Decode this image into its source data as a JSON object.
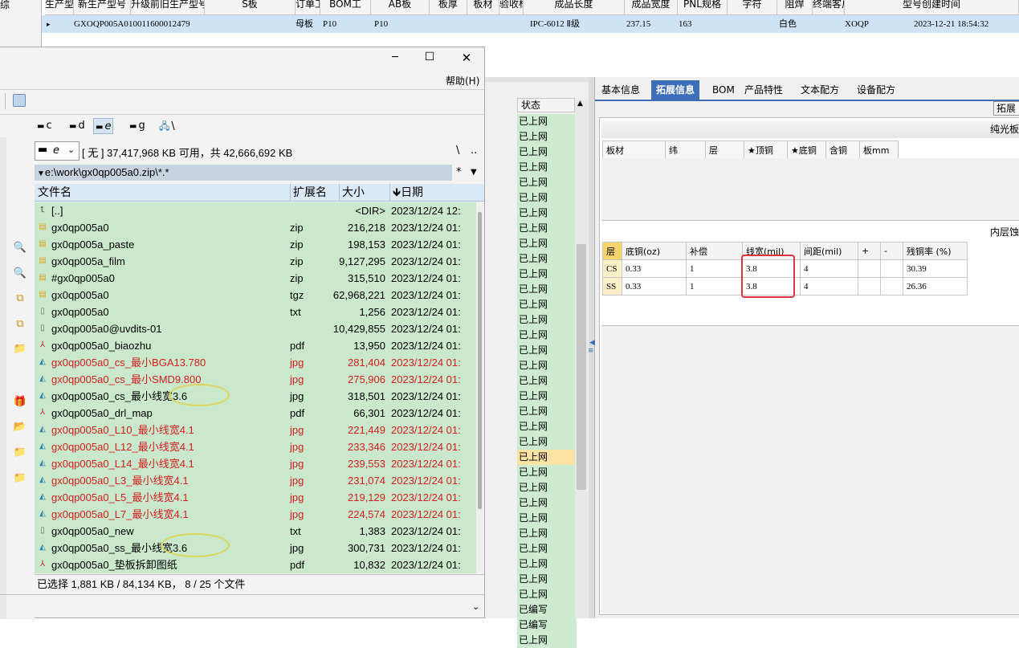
{
  "top_grid": {
    "left_stub": "综",
    "headers": [
      "生产型号",
      "新生产型号",
      "升级前旧生产型号",
      "S板",
      "订单工",
      "BOM工",
      "AB板",
      "板厚",
      "板材",
      "验收标准",
      "成品长度",
      "成品宽度",
      "PNL规格",
      "字符",
      "阻焊",
      "终端客户代码",
      "型号创建时间"
    ],
    "row": {
      "marker": "▸",
      "cells": [
        "GXOQP005A0",
        "10011600012479",
        "",
        "母板",
        "P10",
        "P10",
        "",
        "",
        "",
        "IPC-6012 Ⅱ级",
        "237.15",
        "163",
        "",
        "白色",
        "XOQP",
        "2023-12-21 18:54:32"
      ]
    }
  },
  "window": {
    "controls": {
      "minimize": "─",
      "maximize": "☐",
      "close": "✕"
    },
    "menu_help": "帮助(H)",
    "drives": [
      "c",
      "d",
      "e",
      "g",
      "\\"
    ],
    "drive_combo": "e",
    "free_space": "[ 无 ]  37,417,968 KB 可用，共 42,666,692 KB",
    "btn_root": "\\",
    "btn_up": "..",
    "path": "e:\\work\\gx0qp005a0.zip\\*.*",
    "path_star": "*",
    "columns": {
      "name": "文件名",
      "ext": "扩展名",
      "size": "大小",
      "date": "日期"
    },
    "files": [
      {
        "icon": "up",
        "name": "[..]",
        "ext": "",
        "size": "<DIR>",
        "date": "2023/12/24 12:",
        "red": false
      },
      {
        "icon": "zip",
        "name": "gx0qp005a0",
        "ext": "zip",
        "size": "216,218",
        "date": "2023/12/24 01:",
        "red": false
      },
      {
        "icon": "zip",
        "name": "gx0qp005a_paste",
        "ext": "zip",
        "size": "198,153",
        "date": "2023/12/24 01:",
        "red": false
      },
      {
        "icon": "zip",
        "name": "gx0qp005a_film",
        "ext": "zip",
        "size": "9,127,295",
        "date": "2023/12/24 01:",
        "red": false
      },
      {
        "icon": "zip",
        "name": "#gx0qp005a0",
        "ext": "zip",
        "size": "315,510",
        "date": "2023/12/24 01:",
        "red": false
      },
      {
        "icon": "zip",
        "name": "gx0qp005a0",
        "ext": "tgz",
        "size": "62,968,221",
        "date": "2023/12/24 01:",
        "red": false
      },
      {
        "icon": "txt",
        "name": "gx0qp005a0",
        "ext": "txt",
        "size": "1,256",
        "date": "2023/12/24 01:",
        "red": false
      },
      {
        "icon": "txt",
        "name": "gx0qp005a0@uvdits-01",
        "ext": "",
        "size": "10,429,855",
        "date": "2023/12/24 01:",
        "red": false
      },
      {
        "icon": "pdf",
        "name": "gx0qp005a0_biaozhu",
        "ext": "pdf",
        "size": "13,950",
        "date": "2023/12/24 01:",
        "red": false
      },
      {
        "icon": "img",
        "name": "gx0qp005a0_cs_最小BGA13.780",
        "ext": "jpg",
        "size": "281,404",
        "date": "2023/12/24 01:",
        "red": true
      },
      {
        "icon": "img",
        "name": "gx0qp005a0_cs_最小SMD9.800",
        "ext": "jpg",
        "size": "275,906",
        "date": "2023/12/24 01:",
        "red": true
      },
      {
        "icon": "img",
        "name": "gx0qp005a0_cs_最小线宽3.6",
        "ext": "jpg",
        "size": "318,501",
        "date": "2023/12/24 01:",
        "red": false
      },
      {
        "icon": "pdf",
        "name": "gx0qp005a0_drl_map",
        "ext": "pdf",
        "size": "66,301",
        "date": "2023/12/24 01:",
        "red": false
      },
      {
        "icon": "img",
        "name": "gx0qp005a0_L10_最小线宽4.1",
        "ext": "jpg",
        "size": "221,449",
        "date": "2023/12/24 01:",
        "red": true
      },
      {
        "icon": "img",
        "name": "gx0qp005a0_L12_最小线宽4.1",
        "ext": "jpg",
        "size": "233,346",
        "date": "2023/12/24 01:",
        "red": true
      },
      {
        "icon": "img",
        "name": "gx0qp005a0_L14_最小线宽4.1",
        "ext": "jpg",
        "size": "239,553",
        "date": "2023/12/24 01:",
        "red": true
      },
      {
        "icon": "img",
        "name": "gx0qp005a0_L3_最小线宽4.1",
        "ext": "jpg",
        "size": "231,074",
        "date": "2023/12/24 01:",
        "red": true
      },
      {
        "icon": "img",
        "name": "gx0qp005a0_L5_最小线宽4.1",
        "ext": "jpg",
        "size": "219,129",
        "date": "2023/12/24 01:",
        "red": true
      },
      {
        "icon": "img",
        "name": "gx0qp005a0_L7_最小线宽4.1",
        "ext": "jpg",
        "size": "224,574",
        "date": "2023/12/24 01:",
        "red": true
      },
      {
        "icon": "txt",
        "name": "gx0qp005a0_new",
        "ext": "txt",
        "size": "1,383",
        "date": "2023/12/24 01:",
        "red": false
      },
      {
        "icon": "img",
        "name": "gx0qp005a0_ss_最小线宽3.6",
        "ext": "jpg",
        "size": "300,731",
        "date": "2023/12/24 01:",
        "red": false
      },
      {
        "icon": "pdf",
        "name": "gx0qp005a0_垫板拆卸图纸",
        "ext": "pdf",
        "size": "10,832",
        "date": "2023/12/24 01:",
        "red": false
      }
    ],
    "status": "已选择 1,881 KB / 84,134 KB， 8 / 25 个文件"
  },
  "mid_column": {
    "header": "状态",
    "items": [
      "已上网",
      "已上网",
      "已上网",
      "已上网",
      "已上网",
      "已上网",
      "已上网",
      "已上网",
      "已上网",
      "已上网",
      "已上网",
      "已上网",
      "已上网",
      "已上网",
      "已上网",
      "已上网",
      "已上网",
      "已上网",
      "已上网",
      "已上网",
      "已上网",
      "已上网",
      "已上网",
      "已上网",
      "已上网",
      "已上网",
      "已上网",
      "已上网",
      "已上网",
      "已上网",
      "已上网",
      "已上网",
      "已编写",
      "已编写",
      "已上网"
    ]
  },
  "right_panel": {
    "tabs": [
      "基本信息",
      "拓展信息",
      "BOM",
      "产品特性",
      "文本配方",
      "设备配方"
    ],
    "active_tab": 1,
    "corner_button": "拓展",
    "section1_title": "纯光板",
    "section1_headers": [
      "板材",
      "纬",
      "层",
      "★顶铜",
      "★底铜",
      "含铜",
      "板mm"
    ],
    "section2_title": "内层蚀",
    "section2_headers": [
      "层",
      "底铜(oz)",
      "补偿",
      "线宽(mil)",
      "间距(mil)",
      "+",
      "-",
      "残铜率 (%)"
    ],
    "section2_rows": [
      [
        "CS",
        "0.33",
        "1",
        "3.8",
        "4",
        "",
        "",
        "30.39"
      ],
      [
        "SS",
        "0.33",
        "1",
        "3.8",
        "4",
        "",
        "",
        "26.36"
      ]
    ]
  },
  "colors": {
    "selected_row": "#cfe3f7",
    "file_bg": "#c9e8cc",
    "red_text": "#d42020",
    "tab_active": "#3d6fb8",
    "highlight_box": "#d9363e",
    "ellipse": "#dcd65a"
  }
}
